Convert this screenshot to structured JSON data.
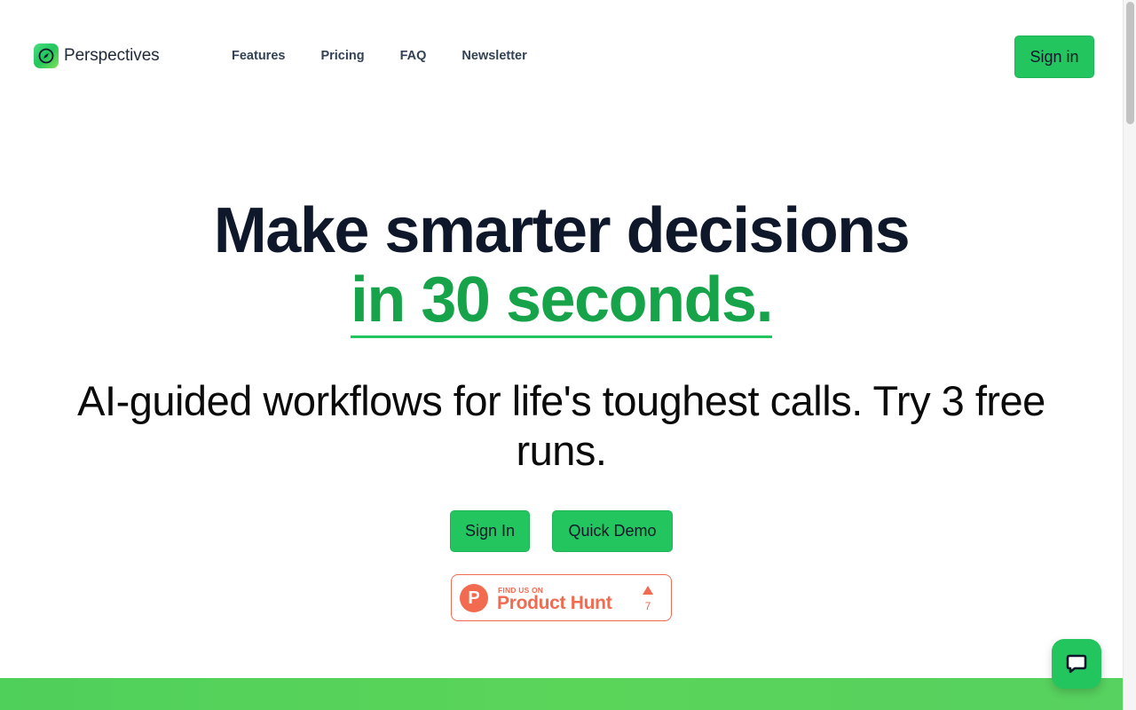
{
  "brand": {
    "name": "Perspectives",
    "logo_icon": "compass-icon",
    "accent": "#22c55e",
    "accent_dark": "#16a34a"
  },
  "nav": {
    "items": [
      {
        "label": "Features"
      },
      {
        "label": "Pricing"
      },
      {
        "label": "FAQ"
      },
      {
        "label": "Newsletter"
      }
    ]
  },
  "header": {
    "signin_label": "Sign in"
  },
  "hero": {
    "line1": "Make smarter decisions",
    "line2": "in 30 seconds.",
    "subtitle": "AI-guided workflows for life's toughest calls. Try 3 free runs.",
    "cta_signin": "Sign In",
    "cta_demo": "Quick Demo"
  },
  "product_hunt": {
    "small_text": "FIND US ON",
    "big_text": "Product Hunt",
    "logo_letter": "P",
    "vote_count": "7",
    "color": "#f26a4f"
  },
  "chat": {
    "icon": "chat-bubble-icon"
  }
}
